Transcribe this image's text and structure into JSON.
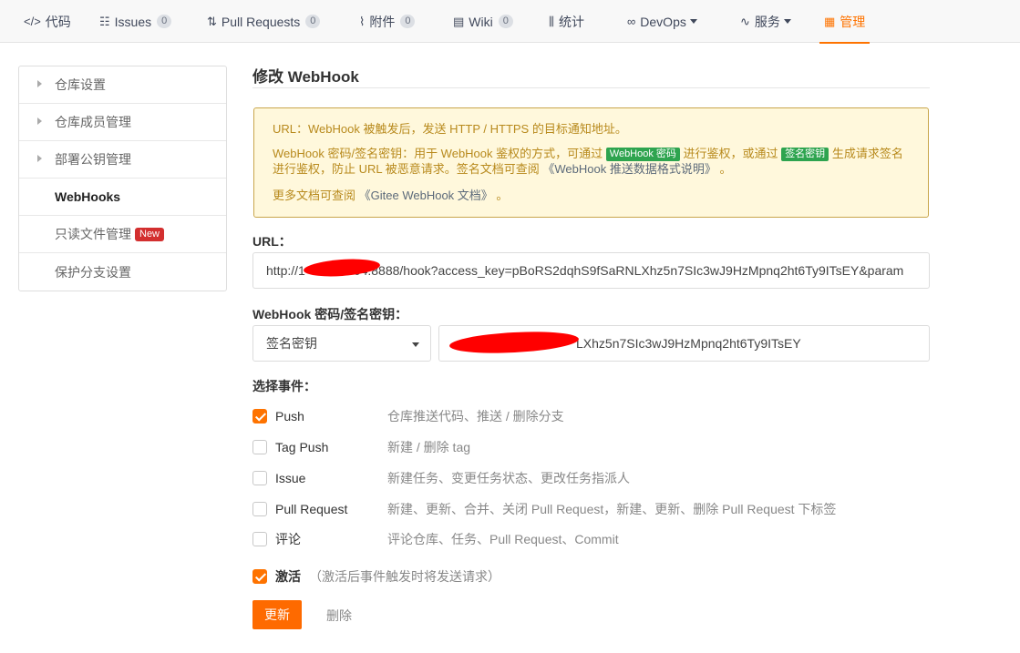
{
  "nav": {
    "tabs": [
      {
        "label": "代码",
        "icon": "code-icon",
        "glyph": "</>"
      },
      {
        "label": "Issues",
        "icon": "issue-icon",
        "glyph": "☷",
        "count": "0"
      },
      {
        "label": "Pull Requests",
        "icon": "pull-request-icon",
        "glyph": "⇅",
        "count": "0"
      },
      {
        "label": "附件",
        "icon": "attachment-icon",
        "glyph": "⌇",
        "count": "0"
      },
      {
        "label": "Wiki",
        "icon": "wiki-icon",
        "glyph": "▤",
        "count": "0"
      },
      {
        "label": "统计",
        "icon": "chart-icon",
        "glyph": "⫼"
      },
      {
        "label": "DevOps",
        "icon": "infinity-icon",
        "glyph": "∞"
      },
      {
        "label": "服务",
        "icon": "pulse-icon",
        "glyph": "∿"
      },
      {
        "label": "管理",
        "icon": "manage-icon",
        "glyph": "▦"
      }
    ],
    "accent_color": "#fe7300"
  },
  "sidebar": {
    "items": [
      {
        "label": "仓库设置"
      },
      {
        "label": "仓库成员管理"
      },
      {
        "label": "部署公钥管理"
      },
      {
        "label": "WebHooks"
      },
      {
        "label": "只读文件管理",
        "badge": "New"
      },
      {
        "label": "保护分支设置"
      }
    ]
  },
  "page": {
    "title": "修改 WebHook"
  },
  "notice": {
    "line1": "URL：WebHook 被触发后，发送 HTTP / HTTPS 的目标通知地址。",
    "line2_a": "WebHook 密码/签名密钥：用于 WebHook 鉴权的方式，可通过",
    "badge_password": "WebHook 密码",
    "line2_b": "进行鉴权，或通过",
    "badge_sign": "签名密钥",
    "line2_c": "生成请求签名进行鉴权，防止 URL 被恶意请求。签名文档可查阅",
    "line2_link": "《WebHook 推送数据格式说明》",
    "line2_end": "。",
    "line3_a": "更多文档可查阅",
    "line3_link": "《Gitee WebHook 文档》",
    "line3_end": "。"
  },
  "form": {
    "url_label": "URL：",
    "url_value_prefix": "http://1",
    "url_value_suffix": "04:8888/hook?access_key=pBoRS2dqhS9fSaRNLXhz5n7SIc3wJ9HzMpnq2ht6Ty9ITsEY&param",
    "secret_label": "WebHook 密码/签名密钥：",
    "secret_type": "签名密钥",
    "secret_value_suffix": "LXhz5n7SIc3wJ9HzMpnq2ht6Ty9ITsEY",
    "events_label": "选择事件：",
    "events": [
      {
        "name": "Push",
        "desc": "仓库推送代码、推送 / 删除分支",
        "checked": true
      },
      {
        "name": "Tag Push",
        "desc": "新建 / 删除 tag",
        "checked": false
      },
      {
        "name": "Issue",
        "desc": "新建任务、变更任务状态、更改任务指派人",
        "checked": false
      },
      {
        "name": "Pull Request",
        "desc": "新建、更新、合并、关闭 Pull Request，新建、更新、删除 Pull Request 下标签",
        "checked": false
      },
      {
        "name": "评论",
        "desc": "评论仓库、任务、Pull Request、Commit",
        "checked": false
      }
    ],
    "activate_label": "激活",
    "activate_hint": "（激活后事件触发时将发送请求）",
    "activate_checked": true
  },
  "actions": {
    "update": "更新",
    "delete": "删除"
  }
}
